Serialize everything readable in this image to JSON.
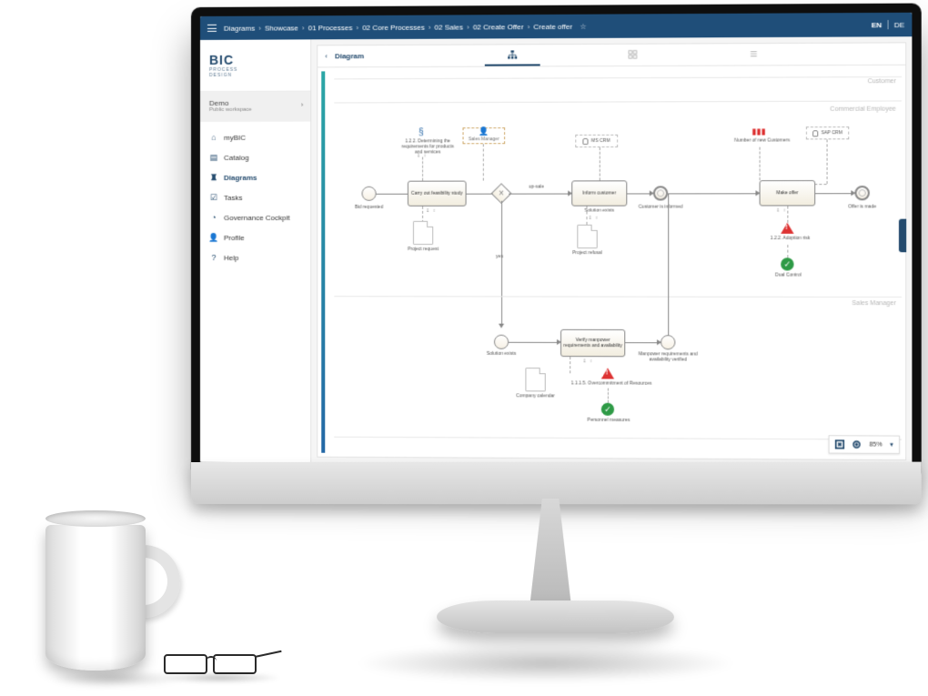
{
  "lang": {
    "en": "EN",
    "de": "DE",
    "active": "EN"
  },
  "breadcrumb": {
    "root": "Diagrams",
    "items": [
      "Showcase",
      "01 Processes",
      "02 Core Processes",
      "02 Sales",
      "02 Create Offer",
      "Create offer"
    ]
  },
  "logo": {
    "brand": "BIC",
    "line1": "PROCESS",
    "line2": "DESIGN"
  },
  "workspace": {
    "name": "Demo",
    "sub": "Public workspace"
  },
  "nav": {
    "mybic": "myBIC",
    "catalog": "Catalog",
    "diagrams": "Diagrams",
    "tasks": "Tasks",
    "governance": "Governance Cockpit",
    "profile": "Profile",
    "help": "Help"
  },
  "page": {
    "title": "Diagram"
  },
  "zoom": {
    "value": "85%"
  },
  "lanes": {
    "customer": "Customer",
    "commercial": "Commercial Employee",
    "sales_manager": "Sales Manager"
  },
  "diagram": {
    "start_event": "Bid requested",
    "task_feasibility": "Carry out feasibility study",
    "doc_request": "Project request",
    "law": "1.2.2. Determining the requirements for products and services",
    "role_sales_manager": "Sales Manager",
    "gateway_label": "",
    "edge_yes": "yes",
    "edge_up": "up-sale",
    "task_inform": "Inform customer",
    "doc_refusal": "Project refusal",
    "evt_informed": "Customer is informed",
    "evt_solution": "Solution exists",
    "task_verify": "Verify manpower requirements and availability",
    "doc_calendar": "Company calendar",
    "risk_resources": "1.1.1.5. Overcommitment of Resources",
    "control_personnel": "Personnel measures",
    "evt_verified": "Manpower requirements and availability verified",
    "sys_crm": "MS CRM",
    "sys_sap": "SAP CRM",
    "kpi": "Number of new Customers",
    "task_offer": "Make offer",
    "risk_price": "1.2.2. Adoption risk",
    "control_dual": "Dual Control",
    "evt_offer": "Offer is made",
    "solution_text": "Solution exists"
  }
}
